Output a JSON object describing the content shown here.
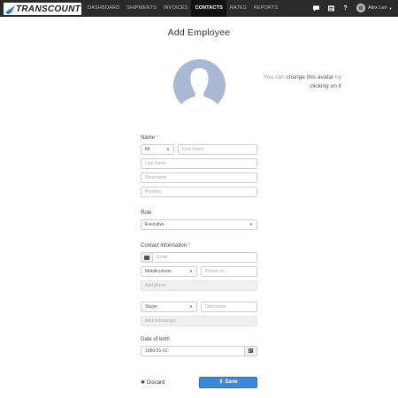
{
  "brand": {
    "name": "TRANSCOUNT"
  },
  "nav": {
    "items": [
      {
        "label": "DASHBOARD"
      },
      {
        "label": "SHIPMENTS"
      },
      {
        "label": "INVOICES"
      },
      {
        "label": "CONTACTS"
      },
      {
        "label": "RATES"
      },
      {
        "label": "REPORTS"
      }
    ],
    "active": "CONTACTS"
  },
  "topbar": {
    "icons": [
      "chat-icon",
      "list-icon",
      "help-icon"
    ],
    "help_glyph": "?",
    "user_name": "Alex Lev"
  },
  "page": {
    "title": "Add Employee"
  },
  "avatar_hint": {
    "prefix": "You can ",
    "link": "change this avatar",
    "suffix": " by",
    "line2": "clicking on it"
  },
  "name_section": {
    "label": "Name",
    "required_mark": "*",
    "title_select": "Mr.",
    "first_name_placeholder": "First Name",
    "last_name_placeholder": "Last Name",
    "shortname_placeholder": "Shortname",
    "position_placeholder": "Position"
  },
  "role_section": {
    "label": "Role",
    "selected": "Executive"
  },
  "contact_section": {
    "label": "Contact information",
    "required_mark": "*",
    "email_placeholder": "Email",
    "phone_type": "Mobile phone",
    "phone_placeholder": "Phone no.",
    "add_phone": "Add phone",
    "messenger_type": "Skype",
    "username_placeholder": "Username",
    "add_messenger": "Add messenger"
  },
  "dob_section": {
    "label": "Date of birth",
    "value": "1980-01-01"
  },
  "actions": {
    "discard": "Discard",
    "discard_glyph": "✖",
    "save": "Save"
  },
  "colors": {
    "topbar": "#2b2b2b",
    "accent": "#3c8ad6",
    "avatar_bg": "#a9b9d4"
  }
}
